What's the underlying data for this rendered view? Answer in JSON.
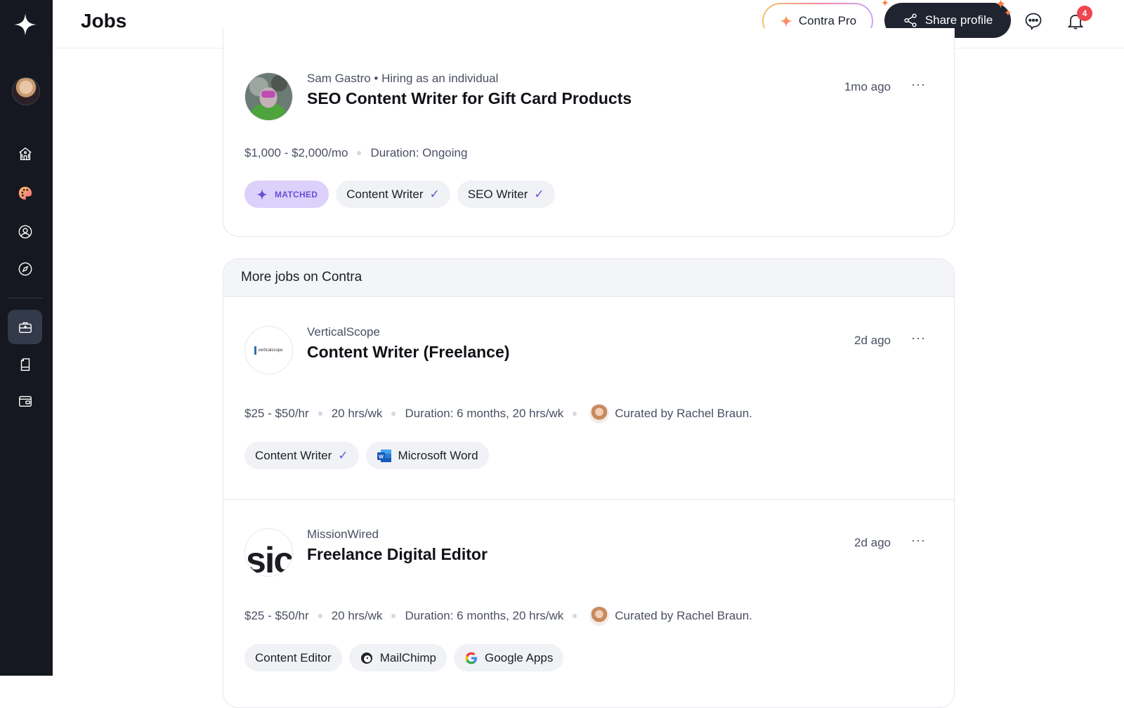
{
  "header": {
    "title": "Jobs",
    "pro_label": "Contra Pro",
    "share_label": "Share profile",
    "notification_count": "4"
  },
  "sidebar": {
    "items": [
      {
        "name": "home-icon",
        "active": false
      },
      {
        "name": "palette-icon",
        "active": false
      },
      {
        "name": "profile-icon",
        "active": false
      },
      {
        "name": "compass-icon",
        "active": false
      },
      {
        "name": "briefcase-icon",
        "active": true
      },
      {
        "name": "document-icon",
        "active": false
      },
      {
        "name": "wallet-icon",
        "active": false
      }
    ]
  },
  "top_job": {
    "company": "Sam Gastro • Hiring as an individual",
    "title": "SEO Content Writer for Gift Card Products",
    "time": "1mo ago",
    "rate": "$1,000 - $2,000/mo",
    "duration": "Duration: Ongoing",
    "matched_label": "MATCHED",
    "tags": [
      "Content Writer",
      "SEO Writer"
    ]
  },
  "more_jobs": {
    "header": "More jobs on Contra",
    "jobs": [
      {
        "company": "VerticalScope",
        "logo_text": "verticalscope",
        "title": "Content Writer (Freelance)",
        "time": "2d ago",
        "rate": "$25 - $50/hr",
        "hours": "20 hrs/wk",
        "duration": "Duration: 6 months, 20 hrs/wk",
        "curated": "Curated by Rachel Braun.",
        "tags": [
          {
            "label": "Content Writer",
            "icon": "check"
          },
          {
            "label": "Microsoft Word",
            "icon": "word-icon"
          }
        ]
      },
      {
        "company": "MissionWired",
        "logo_text": "sic",
        "title": "Freelance Digital Editor",
        "time": "2d ago",
        "rate": "$25 - $50/hr",
        "hours": "20 hrs/wk",
        "duration": "Duration: 6 months, 20 hrs/wk",
        "curated": "Curated by Rachel Braun.",
        "tags": [
          {
            "label": "Content Editor",
            "icon": null
          },
          {
            "label": "MailChimp",
            "icon": "mailchimp-icon"
          },
          {
            "label": "Google Apps",
            "icon": "google-icon"
          }
        ]
      }
    ]
  },
  "more_label": "···",
  "colors": {
    "sidebar_bg": "#151821",
    "accent_purple": "#6a4fd8",
    "matched_bg": "#dcd1fb",
    "badge_red": "#f0464d",
    "share_btn_bg": "#1f2430"
  }
}
